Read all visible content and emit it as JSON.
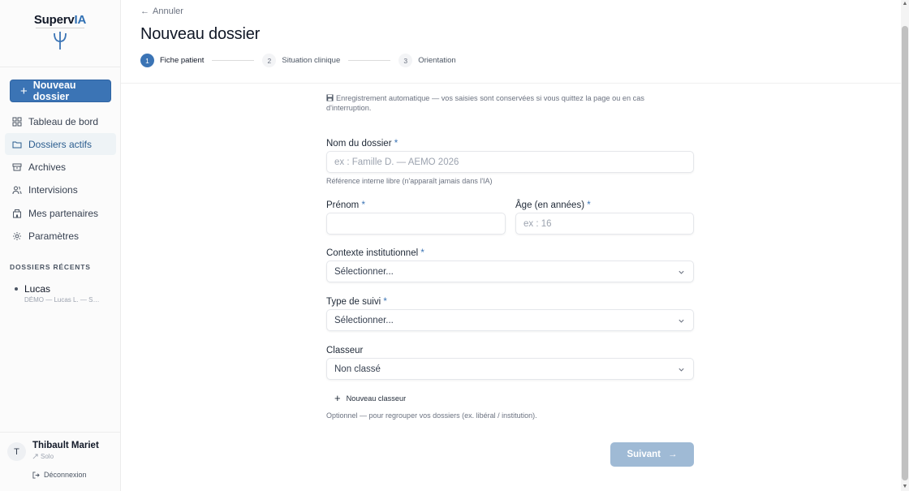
{
  "brand": {
    "name_prefix": "Superv",
    "name_suffix": "IA"
  },
  "sidebar": {
    "new_button": "Nouveau dossier",
    "items": [
      {
        "label": "Tableau de bord",
        "icon": "dashboard-icon"
      },
      {
        "label": "Dossiers actifs",
        "icon": "folder-open-icon",
        "active": true
      },
      {
        "label": "Archives",
        "icon": "archive-icon"
      },
      {
        "label": "Intervisions",
        "icon": "users-icon"
      },
      {
        "label": "Mes partenaires",
        "icon": "building-icon"
      },
      {
        "label": "Paramètres",
        "icon": "gear-icon"
      }
    ],
    "recent_title": "DOSSIERS RÉCENTS",
    "recent": [
      {
        "name": "Lucas",
        "sub": "DÉMO — Lucas L. — Suivi"
      }
    ],
    "user": {
      "initial": "T",
      "name": "Thibault Mariet",
      "plan": "Solo",
      "logout": "Déconnexion"
    }
  },
  "main": {
    "cancel": "Annuler",
    "title": "Nouveau dossier",
    "steps": [
      {
        "num": "1",
        "label": "Fiche patient",
        "active": true
      },
      {
        "num": "2",
        "label": "Situation clinique"
      },
      {
        "num": "3",
        "label": "Orientation"
      }
    ],
    "autosave": "Enregistrement automatique — vos saisies sont conservées si vous quittez la page ou en cas d'interruption.",
    "form": {
      "nom_label": "Nom du dossier",
      "nom_placeholder": "ex : Famille D. — AEMO 2026",
      "nom_help": "Référence interne libre (n'apparaît jamais dans l'IA)",
      "prenom_label": "Prénom",
      "prenom_value": "",
      "age_label": "Âge (en années)",
      "age_placeholder": "ex : 16",
      "contexte_label": "Contexte institutionnel",
      "contexte_value": "Sélectionner...",
      "type_label": "Type de suivi",
      "type_value": "Sélectionner...",
      "classeur_label": "Classeur",
      "classeur_value": "Non classé",
      "new_classeur": "Nouveau classeur",
      "classeur_help": "Optionnel — pour regrouper vos dossiers (ex. libéral / institution).",
      "required_mark": "*"
    },
    "next_button": "Suivant"
  },
  "colors": {
    "accent": "#3b74b5",
    "next_disabled": "#9fbad5"
  }
}
